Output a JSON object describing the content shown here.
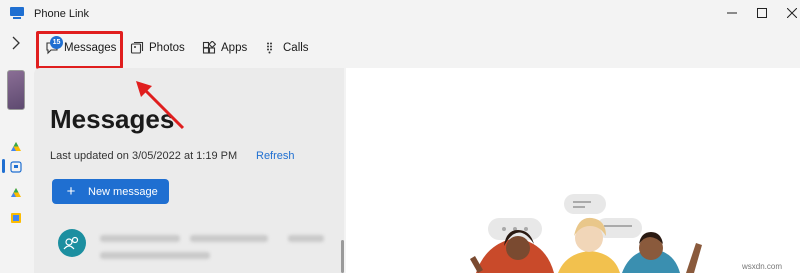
{
  "window": {
    "title": "Phone Link"
  },
  "nav": {
    "tabs": [
      {
        "label": "Messages",
        "icon": "messages-icon",
        "badge": "15"
      },
      {
        "label": "Photos",
        "icon": "photos-icon"
      },
      {
        "label": "Apps",
        "icon": "apps-icon"
      },
      {
        "label": "Calls",
        "icon": "calls-icon"
      }
    ]
  },
  "messages": {
    "title": "Messages",
    "last_updated": "Last updated on 3/05/2022 at 1:19 PM",
    "refresh_label": "Refresh",
    "new_message_label": "New message"
  },
  "watermark": "wsxdn.com",
  "colors": {
    "accent": "#1f6fd1",
    "highlight": "#e01e1e",
    "pane_bg": "#ebebeb",
    "window_bg": "#f3f3f3"
  }
}
